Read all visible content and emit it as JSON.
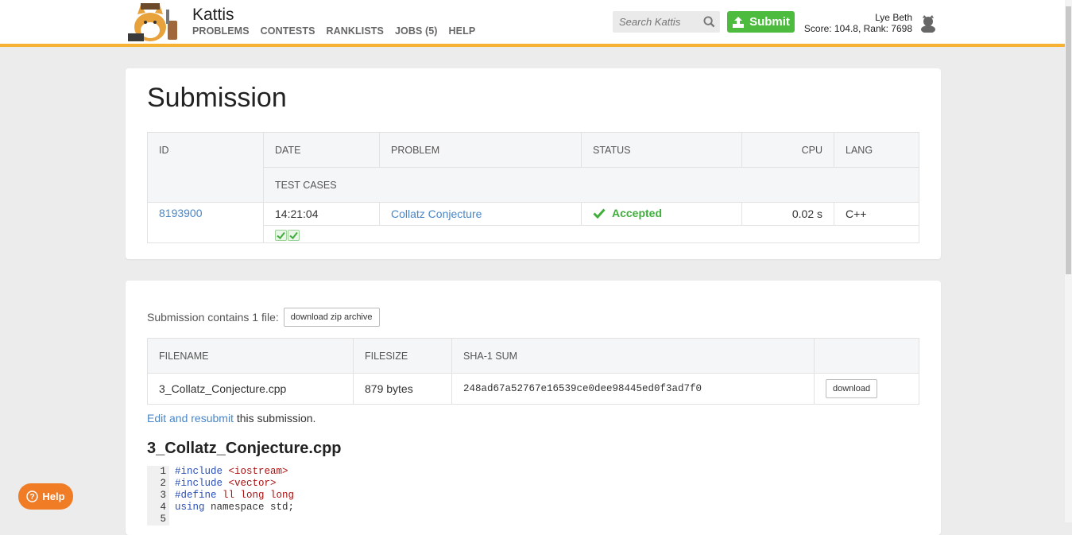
{
  "header": {
    "brand": "Kattis",
    "nav": [
      "PROBLEMS",
      "CONTESTS",
      "RANKLISTS",
      "JOBS (5)",
      "HELP"
    ],
    "search_placeholder": "Search Kattis",
    "submit_label": "Submit",
    "user_name": "Lye Beth",
    "user_stats": "Score: 104.8, Rank: 7698",
    "accent_color": "#f5b235",
    "submit_color": "#4cbb3e"
  },
  "submission": {
    "title": "Submission",
    "headers": {
      "id": "ID",
      "date": "DATE",
      "problem": "PROBLEM",
      "status": "STATUS",
      "cpu": "CPU",
      "lang": "LANG",
      "test_cases": "TEST CASES"
    },
    "row": {
      "id": "8193900",
      "date": "14:21:04",
      "problem": "Collatz Conjecture",
      "status": "Accepted",
      "cpu": "0.02 s",
      "lang": "C++",
      "test_cases_passed": 2
    },
    "status_color": "#3fae3b"
  },
  "files": {
    "summary": "Submission contains 1 file:",
    "download_zip_label": "download zip archive",
    "headers": {
      "filename": "FILENAME",
      "filesize": "FILESIZE",
      "sha1": "SHA-1 SUM"
    },
    "rows": [
      {
        "filename": "3_Collatz_Conjecture.cpp",
        "filesize": "879 bytes",
        "sha1": "248ad67a52767e16539ce0dee98445ed0f3ad7f0",
        "download_label": "download"
      }
    ],
    "edit_link": "Edit and resubmit",
    "edit_suffix": " this submission.",
    "file_title": "3_Collatz_Conjecture.cpp"
  },
  "code": {
    "lines": [
      {
        "n": "1",
        "a": "#include",
        "b": " <iostream>"
      },
      {
        "n": "2",
        "a": "#include",
        "b": " <vector>"
      },
      {
        "n": "3",
        "a": "#define",
        "b": " ll long long"
      },
      {
        "n": "4",
        "a": "using",
        "b": " namespace std;"
      },
      {
        "n": "5",
        "a": "",
        "b": ""
      }
    ]
  },
  "help": {
    "label": "Help",
    "color": "#f07c26"
  }
}
